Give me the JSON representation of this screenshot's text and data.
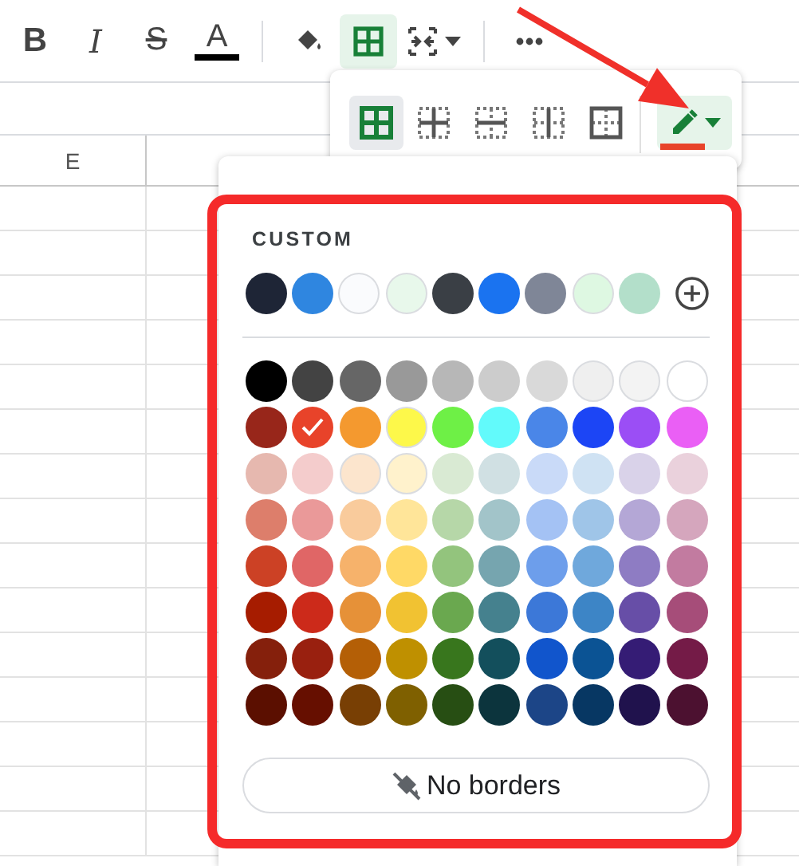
{
  "toolbar": {
    "groups": [
      {
        "items": [
          {
            "kind": "bold",
            "label": "B",
            "selected": false
          },
          {
            "kind": "italic",
            "label": "I",
            "selected": false
          },
          {
            "kind": "strikethrough",
            "label": "S",
            "selected": false
          },
          {
            "kind": "text-color",
            "label": "A",
            "selected": false
          }
        ]
      },
      {
        "items": [
          {
            "kind": "fill-color",
            "selected": false
          },
          {
            "kind": "borders",
            "selected": true
          },
          {
            "kind": "merge",
            "selected": false
          }
        ]
      },
      {
        "items": [
          {
            "kind": "more",
            "selected": false
          }
        ]
      }
    ]
  },
  "column_headers": [
    "E"
  ],
  "borders_menu": {
    "options": [
      {
        "kind": "all",
        "selected": true
      },
      {
        "kind": "inner",
        "selected": false
      },
      {
        "kind": "horizontal",
        "selected": false
      },
      {
        "kind": "vertical",
        "selected": false
      },
      {
        "kind": "outer",
        "selected": false
      }
    ],
    "color_button": {
      "expanded": true
    }
  },
  "palette": {
    "custom_label": "CUSTOM",
    "custom": [
      {
        "color": "#1e2536",
        "selected": false
      },
      {
        "color": "#2f86e0",
        "selected": false
      },
      {
        "color": "#fafbfd",
        "selected": false
      },
      {
        "color": "#e8f8eb",
        "selected": false
      },
      {
        "color": "#3a3f45",
        "selected": false
      },
      {
        "color": "#1a73f0",
        "selected": false
      },
      {
        "color": "#7f8697",
        "selected": false
      },
      {
        "color": "#def8e2",
        "selected": false
      },
      {
        "color": "#b3dfca",
        "selected": false
      }
    ],
    "rows": [
      [
        {
          "color": "#000000",
          "selected": false
        },
        {
          "color": "#434343",
          "selected": false
        },
        {
          "color": "#666666",
          "selected": false
        },
        {
          "color": "#999999",
          "selected": false
        },
        {
          "color": "#b7b7b7",
          "selected": false
        },
        {
          "color": "#cccccc",
          "selected": false
        },
        {
          "color": "#d9d9d9",
          "selected": false
        },
        {
          "color": "#efefef",
          "selected": false
        },
        {
          "color": "#f3f3f3",
          "selected": false
        },
        {
          "color": "#ffffff",
          "selected": false
        }
      ],
      [
        {
          "color": "#98261a",
          "selected": false
        },
        {
          "color": "#e8432a",
          "selected": true
        },
        {
          "color": "#f4992f",
          "selected": false
        },
        {
          "color": "#fdf84a",
          "selected": false
        },
        {
          "color": "#6ef046",
          "selected": false
        },
        {
          "color": "#62fafb",
          "selected": false
        },
        {
          "color": "#4a86e8",
          "selected": false
        },
        {
          "color": "#1c45f5",
          "selected": false
        },
        {
          "color": "#9b4ef5",
          "selected": false
        },
        {
          "color": "#ea5ff5",
          "selected": false
        }
      ],
      [
        {
          "color": "#e6b8af",
          "selected": false
        },
        {
          "color": "#f4cccc",
          "selected": false
        },
        {
          "color": "#fce5cd",
          "selected": false
        },
        {
          "color": "#fff2cc",
          "selected": false
        },
        {
          "color": "#d9ead3",
          "selected": false
        },
        {
          "color": "#d0e0e3",
          "selected": false
        },
        {
          "color": "#c9daf8",
          "selected": false
        },
        {
          "color": "#cfe2f3",
          "selected": false
        },
        {
          "color": "#d9d2e9",
          "selected": false
        },
        {
          "color": "#ead1dc",
          "selected": false
        }
      ],
      [
        {
          "color": "#dd7e6b",
          "selected": false
        },
        {
          "color": "#ea9999",
          "selected": false
        },
        {
          "color": "#f9cb9c",
          "selected": false
        },
        {
          "color": "#ffe599",
          "selected": false
        },
        {
          "color": "#b6d7a8",
          "selected": false
        },
        {
          "color": "#a2c4c9",
          "selected": false
        },
        {
          "color": "#a4c2f4",
          "selected": false
        },
        {
          "color": "#9fc5e8",
          "selected": false
        },
        {
          "color": "#b4a7d6",
          "selected": false
        },
        {
          "color": "#d5a6bd",
          "selected": false
        }
      ],
      [
        {
          "color": "#cc4125",
          "selected": false
        },
        {
          "color": "#e06666",
          "selected": false
        },
        {
          "color": "#f6b26b",
          "selected": false
        },
        {
          "color": "#ffd966",
          "selected": false
        },
        {
          "color": "#93c47d",
          "selected": false
        },
        {
          "color": "#76a5af",
          "selected": false
        },
        {
          "color": "#6d9eeb",
          "selected": false
        },
        {
          "color": "#6fa8dc",
          "selected": false
        },
        {
          "color": "#8e7cc3",
          "selected": false
        },
        {
          "color": "#c27ba0",
          "selected": false
        }
      ],
      [
        {
          "color": "#a61c00",
          "selected": false
        },
        {
          "color": "#cc2a1a",
          "selected": false
        },
        {
          "color": "#e69138",
          "selected": false
        },
        {
          "color": "#f1c232",
          "selected": false
        },
        {
          "color": "#6aa84f",
          "selected": false
        },
        {
          "color": "#45818e",
          "selected": false
        },
        {
          "color": "#3c78d8",
          "selected": false
        },
        {
          "color": "#3d85c6",
          "selected": false
        },
        {
          "color": "#674ea7",
          "selected": false
        },
        {
          "color": "#a64d79",
          "selected": false
        }
      ],
      [
        {
          "color": "#85200c",
          "selected": false
        },
        {
          "color": "#99200f",
          "selected": false
        },
        {
          "color": "#b45f06",
          "selected": false
        },
        {
          "color": "#bf9000",
          "selected": false
        },
        {
          "color": "#38761d",
          "selected": false
        },
        {
          "color": "#134f5c",
          "selected": false
        },
        {
          "color": "#1155cc",
          "selected": false
        },
        {
          "color": "#0b5394",
          "selected": false
        },
        {
          "color": "#351c75",
          "selected": false
        },
        {
          "color": "#741b47",
          "selected": false
        }
      ],
      [
        {
          "color": "#5b0f00",
          "selected": false
        },
        {
          "color": "#660f00",
          "selected": false
        },
        {
          "color": "#783f04",
          "selected": false
        },
        {
          "color": "#7f6000",
          "selected": false
        },
        {
          "color": "#274e13",
          "selected": false
        },
        {
          "color": "#0c343d",
          "selected": false
        },
        {
          "color": "#1c4587",
          "selected": false
        },
        {
          "color": "#073763",
          "selected": false
        },
        {
          "color": "#20124d",
          "selected": false
        },
        {
          "color": "#4c1130",
          "selected": false
        }
      ]
    ],
    "no_borders_label": "No borders"
  }
}
